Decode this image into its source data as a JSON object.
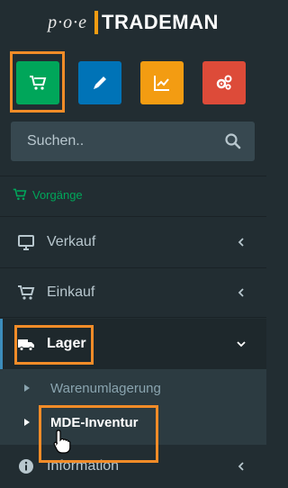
{
  "logo": {
    "poe": "p·o·e",
    "brand": "TRADEMAN"
  },
  "tiles": [
    {
      "name": "cart",
      "color": "#00a65a"
    },
    {
      "name": "pencil",
      "color": "#0073b7"
    },
    {
      "name": "chart",
      "color": "#f39c12"
    },
    {
      "name": "settings",
      "color": "#dd4b39"
    }
  ],
  "search": {
    "placeholder": "Suchen.."
  },
  "menu": {
    "header": "Vorgänge",
    "items": [
      {
        "label": "Verkauf",
        "icon": "monitor"
      },
      {
        "label": "Einkauf",
        "icon": "cart"
      },
      {
        "label": "Lager",
        "icon": "truck"
      },
      {
        "label": "Information",
        "icon": "info"
      }
    ],
    "lager_sub": [
      {
        "label": "Warenumlagerung"
      },
      {
        "label": "MDE-Inventur"
      }
    ]
  }
}
